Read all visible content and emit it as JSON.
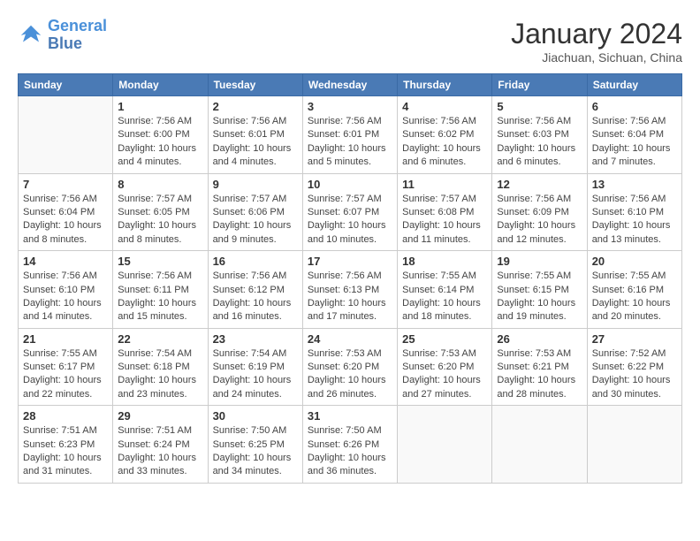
{
  "header": {
    "logo_line1": "General",
    "logo_line2": "Blue",
    "month_title": "January 2024",
    "location": "Jiachuan, Sichuan, China"
  },
  "days_of_week": [
    "Sunday",
    "Monday",
    "Tuesday",
    "Wednesday",
    "Thursday",
    "Friday",
    "Saturday"
  ],
  "weeks": [
    [
      {
        "day": "",
        "info": ""
      },
      {
        "day": "1",
        "info": "Sunrise: 7:56 AM\nSunset: 6:00 PM\nDaylight: 10 hours\nand 4 minutes."
      },
      {
        "day": "2",
        "info": "Sunrise: 7:56 AM\nSunset: 6:01 PM\nDaylight: 10 hours\nand 4 minutes."
      },
      {
        "day": "3",
        "info": "Sunrise: 7:56 AM\nSunset: 6:01 PM\nDaylight: 10 hours\nand 5 minutes."
      },
      {
        "day": "4",
        "info": "Sunrise: 7:56 AM\nSunset: 6:02 PM\nDaylight: 10 hours\nand 6 minutes."
      },
      {
        "day": "5",
        "info": "Sunrise: 7:56 AM\nSunset: 6:03 PM\nDaylight: 10 hours\nand 6 minutes."
      },
      {
        "day": "6",
        "info": "Sunrise: 7:56 AM\nSunset: 6:04 PM\nDaylight: 10 hours\nand 7 minutes."
      }
    ],
    [
      {
        "day": "7",
        "info": "Sunrise: 7:56 AM\nSunset: 6:04 PM\nDaylight: 10 hours\nand 8 minutes."
      },
      {
        "day": "8",
        "info": "Sunrise: 7:57 AM\nSunset: 6:05 PM\nDaylight: 10 hours\nand 8 minutes."
      },
      {
        "day": "9",
        "info": "Sunrise: 7:57 AM\nSunset: 6:06 PM\nDaylight: 10 hours\nand 9 minutes."
      },
      {
        "day": "10",
        "info": "Sunrise: 7:57 AM\nSunset: 6:07 PM\nDaylight: 10 hours\nand 10 minutes."
      },
      {
        "day": "11",
        "info": "Sunrise: 7:57 AM\nSunset: 6:08 PM\nDaylight: 10 hours\nand 11 minutes."
      },
      {
        "day": "12",
        "info": "Sunrise: 7:56 AM\nSunset: 6:09 PM\nDaylight: 10 hours\nand 12 minutes."
      },
      {
        "day": "13",
        "info": "Sunrise: 7:56 AM\nSunset: 6:10 PM\nDaylight: 10 hours\nand 13 minutes."
      }
    ],
    [
      {
        "day": "14",
        "info": "Sunrise: 7:56 AM\nSunset: 6:10 PM\nDaylight: 10 hours\nand 14 minutes."
      },
      {
        "day": "15",
        "info": "Sunrise: 7:56 AM\nSunset: 6:11 PM\nDaylight: 10 hours\nand 15 minutes."
      },
      {
        "day": "16",
        "info": "Sunrise: 7:56 AM\nSunset: 6:12 PM\nDaylight: 10 hours\nand 16 minutes."
      },
      {
        "day": "17",
        "info": "Sunrise: 7:56 AM\nSunset: 6:13 PM\nDaylight: 10 hours\nand 17 minutes."
      },
      {
        "day": "18",
        "info": "Sunrise: 7:55 AM\nSunset: 6:14 PM\nDaylight: 10 hours\nand 18 minutes."
      },
      {
        "day": "19",
        "info": "Sunrise: 7:55 AM\nSunset: 6:15 PM\nDaylight: 10 hours\nand 19 minutes."
      },
      {
        "day": "20",
        "info": "Sunrise: 7:55 AM\nSunset: 6:16 PM\nDaylight: 10 hours\nand 20 minutes."
      }
    ],
    [
      {
        "day": "21",
        "info": "Sunrise: 7:55 AM\nSunset: 6:17 PM\nDaylight: 10 hours\nand 22 minutes."
      },
      {
        "day": "22",
        "info": "Sunrise: 7:54 AM\nSunset: 6:18 PM\nDaylight: 10 hours\nand 23 minutes."
      },
      {
        "day": "23",
        "info": "Sunrise: 7:54 AM\nSunset: 6:19 PM\nDaylight: 10 hours\nand 24 minutes."
      },
      {
        "day": "24",
        "info": "Sunrise: 7:53 AM\nSunset: 6:20 PM\nDaylight: 10 hours\nand 26 minutes."
      },
      {
        "day": "25",
        "info": "Sunrise: 7:53 AM\nSunset: 6:20 PM\nDaylight: 10 hours\nand 27 minutes."
      },
      {
        "day": "26",
        "info": "Sunrise: 7:53 AM\nSunset: 6:21 PM\nDaylight: 10 hours\nand 28 minutes."
      },
      {
        "day": "27",
        "info": "Sunrise: 7:52 AM\nSunset: 6:22 PM\nDaylight: 10 hours\nand 30 minutes."
      }
    ],
    [
      {
        "day": "28",
        "info": "Sunrise: 7:51 AM\nSunset: 6:23 PM\nDaylight: 10 hours\nand 31 minutes."
      },
      {
        "day": "29",
        "info": "Sunrise: 7:51 AM\nSunset: 6:24 PM\nDaylight: 10 hours\nand 33 minutes."
      },
      {
        "day": "30",
        "info": "Sunrise: 7:50 AM\nSunset: 6:25 PM\nDaylight: 10 hours\nand 34 minutes."
      },
      {
        "day": "31",
        "info": "Sunrise: 7:50 AM\nSunset: 6:26 PM\nDaylight: 10 hours\nand 36 minutes."
      },
      {
        "day": "",
        "info": ""
      },
      {
        "day": "",
        "info": ""
      },
      {
        "day": "",
        "info": ""
      }
    ]
  ]
}
